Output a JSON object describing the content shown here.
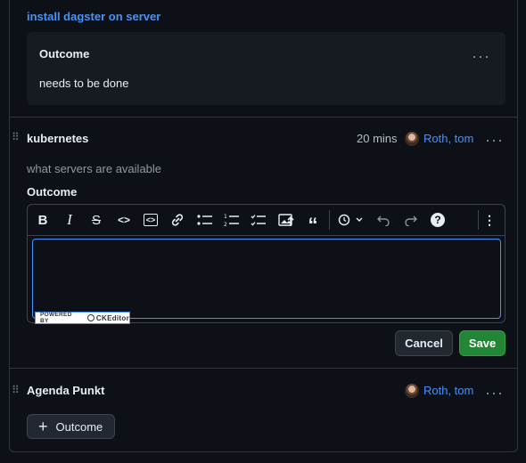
{
  "top": {
    "title": "install dagster on server"
  },
  "card": {
    "heading": "Outcome",
    "text": "needs to be done"
  },
  "item1": {
    "title": "kubernetes",
    "duration": "20 mins",
    "owner": "Roth, tom",
    "description": "what servers are available",
    "outcome_label": "Outcome"
  },
  "editor": {
    "toolbar": [
      "bold-icon",
      "italic-icon",
      "strikethrough-icon",
      "code-icon",
      "code-block-icon",
      "link-icon",
      "bulleted-list-icon",
      "numbered-list-icon",
      "todo-list-icon",
      "image-icon",
      "blockquote-icon",
      "history-icon",
      "undo-icon",
      "redo-icon",
      "help-icon",
      "more-icon"
    ],
    "powered_label": "POWERED BY",
    "brand": "CKEditor"
  },
  "actions": {
    "cancel": "Cancel",
    "save": "Save"
  },
  "item2": {
    "title": "Agenda Punkt",
    "owner": "Roth, tom",
    "add_outcome": "Outcome"
  },
  "colors": {
    "accent": "#4493f8",
    "save": "#238636",
    "background": "#0d1117"
  }
}
